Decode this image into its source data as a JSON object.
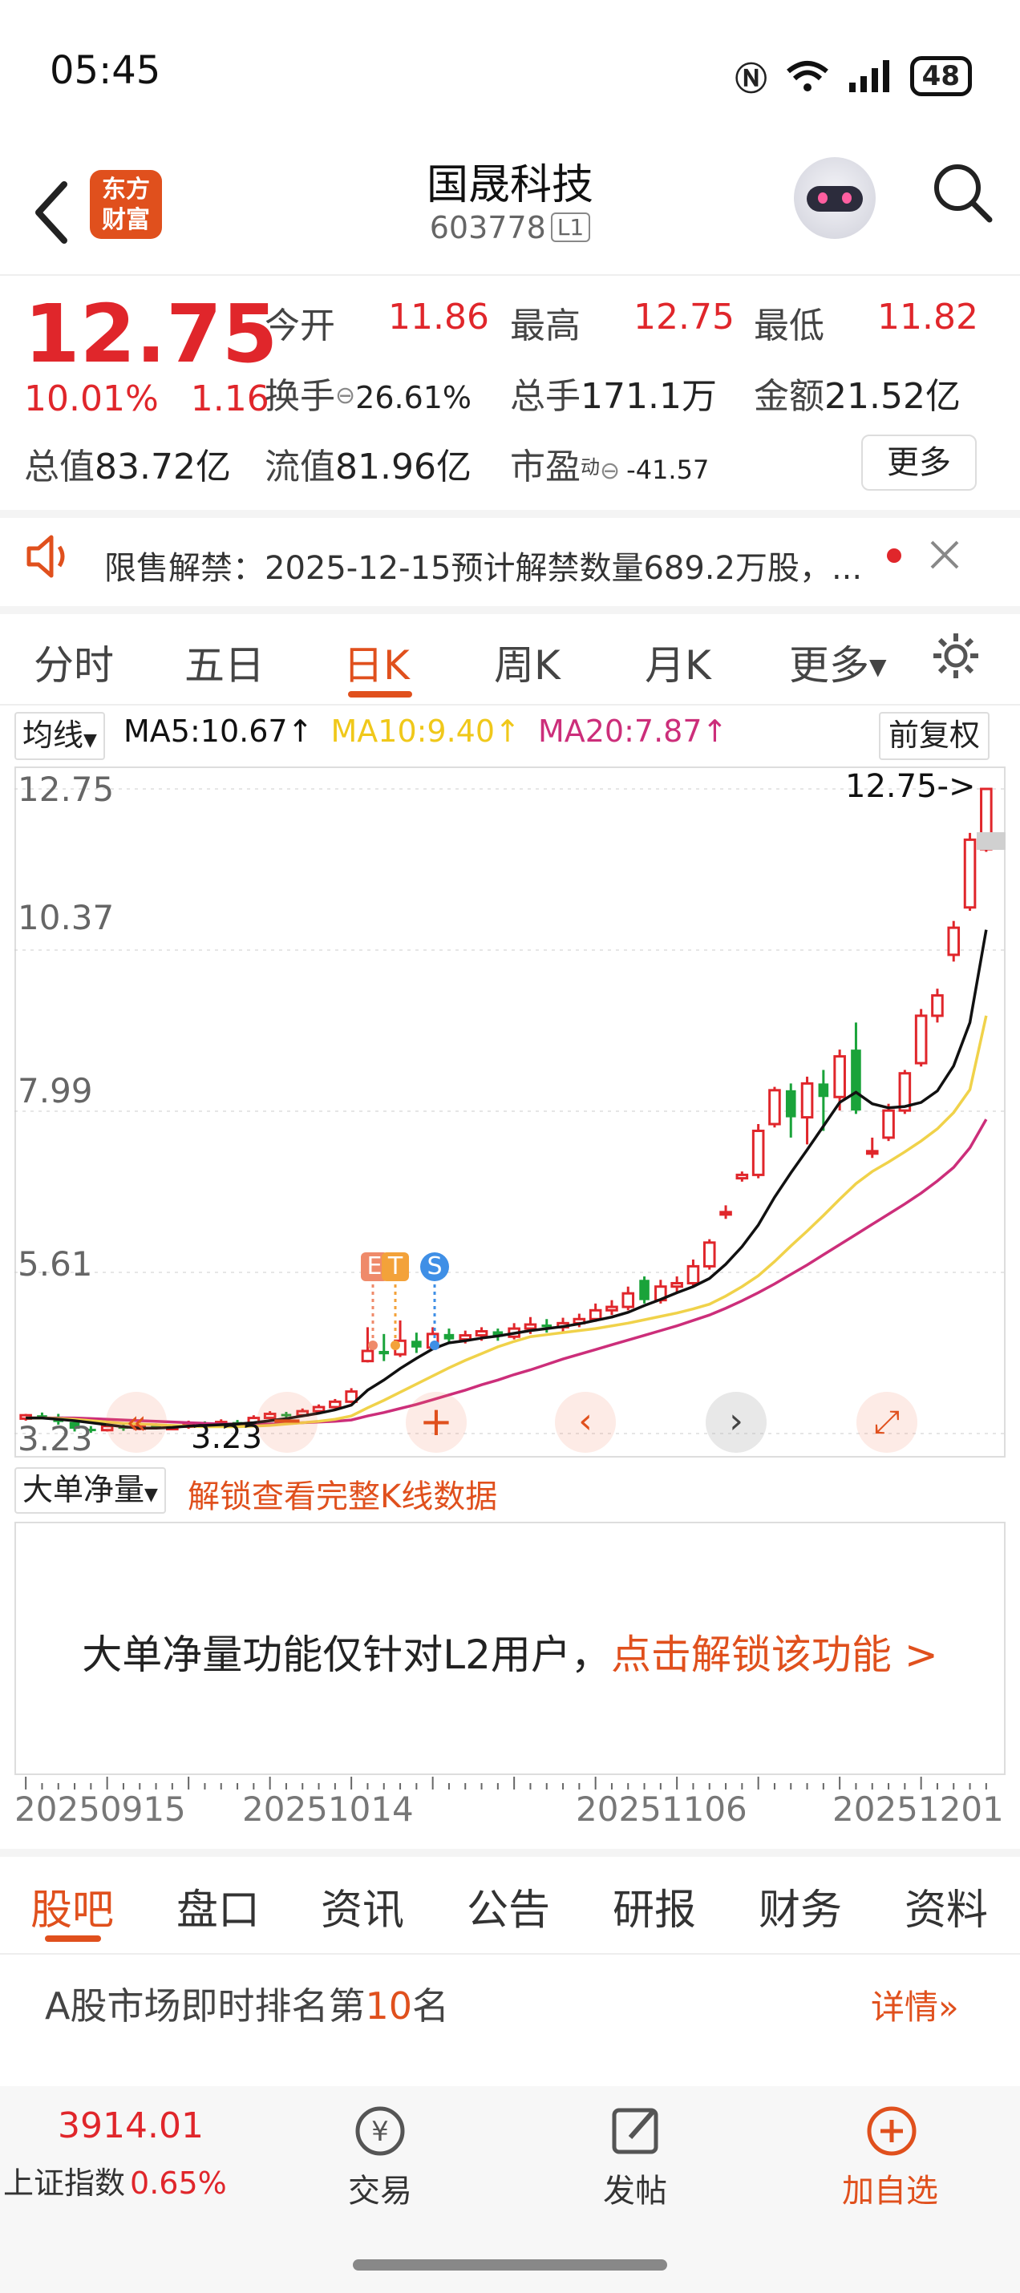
{
  "status": {
    "time": "05:45",
    "battery": "48"
  },
  "header": {
    "logo_line1": "东方",
    "logo_line2": "财富",
    "name": "国晟科技",
    "code": "603778",
    "level": "L1"
  },
  "quote": {
    "price": "12.75",
    "change_pct": "10.01%",
    "change": "1.16",
    "open_label": "今开",
    "open": "11.86",
    "high_label": "最高",
    "high": "12.75",
    "low_label": "最低",
    "low": "11.82",
    "turnover_label": "换手",
    "turnover": "26.61%",
    "volume_label": "总手",
    "volume": "171.1万",
    "amount_label": "金额",
    "amount": "21.52亿",
    "mcap_label": "总值",
    "mcap": "83.72亿",
    "float_label": "流值",
    "float_cap": "81.96亿",
    "pe_label": "市盈",
    "pe_sup": "动",
    "pe": "-41.57",
    "more": "更多"
  },
  "notice": {
    "text": "限售解禁：2025-12-15预计解禁数量689.2万股，..."
  },
  "tabs": [
    "分时",
    "五日",
    "日K",
    "周K",
    "月K",
    "更多"
  ],
  "ma": {
    "selector": "均线",
    "ma5": "MA5:10.67",
    "ma10": "MA10:9.40",
    "ma20": "MA20:7.87",
    "adjust": "前复权"
  },
  "chart": {
    "y_labels": [
      "12.75",
      "10.37",
      "7.99",
      "5.61",
      "3.23"
    ],
    "last_label": "12.75->",
    "low_label": "3.23",
    "markers": [
      "E",
      "T",
      "S"
    ],
    "colors": {
      "up": "#e0262b",
      "down": "#1aa33a",
      "ma5": "#111111",
      "ma10": "#f0d24a",
      "ma20": "#cc2e7a"
    }
  },
  "chart_data": {
    "type": "candlestick",
    "ylim": [
      3.23,
      12.75
    ],
    "candles": [
      [
        3.45,
        3.5,
        3.42,
        3.52
      ],
      [
        3.5,
        3.48,
        3.44,
        3.54
      ],
      [
        3.48,
        3.4,
        3.36,
        3.52
      ],
      [
        3.4,
        3.3,
        3.26,
        3.44
      ],
      [
        3.3,
        3.28,
        3.24,
        3.34
      ],
      [
        3.28,
        3.34,
        3.26,
        3.38
      ],
      [
        3.34,
        3.3,
        3.27,
        3.37
      ],
      [
        3.3,
        3.35,
        3.28,
        3.4
      ],
      [
        3.35,
        3.32,
        3.29,
        3.38
      ],
      [
        3.32,
        3.33,
        3.28,
        3.36
      ],
      [
        3.33,
        3.38,
        3.3,
        3.42
      ],
      [
        3.38,
        3.36,
        3.32,
        3.41
      ],
      [
        3.36,
        3.4,
        3.33,
        3.44
      ],
      [
        3.4,
        3.38,
        3.35,
        3.43
      ],
      [
        3.38,
        3.46,
        3.36,
        3.5
      ],
      [
        3.46,
        3.52,
        3.44,
        3.56
      ],
      [
        3.52,
        3.5,
        3.46,
        3.55
      ],
      [
        3.5,
        3.56,
        3.48,
        3.6
      ],
      [
        3.56,
        3.62,
        3.54,
        3.66
      ],
      [
        3.62,
        3.7,
        3.6,
        3.74
      ],
      [
        3.7,
        3.85,
        3.68,
        3.9
      ],
      [
        4.3,
        4.45,
        4.28,
        4.8
      ],
      [
        4.45,
        4.4,
        4.3,
        4.7
      ],
      [
        4.4,
        4.6,
        4.36,
        4.9
      ],
      [
        4.6,
        4.5,
        4.42,
        4.72
      ],
      [
        4.5,
        4.7,
        4.46,
        4.8
      ],
      [
        4.7,
        4.62,
        4.55,
        4.78
      ],
      [
        4.62,
        4.68,
        4.56,
        4.75
      ],
      [
        4.68,
        4.74,
        4.6,
        4.8
      ],
      [
        4.74,
        4.66,
        4.6,
        4.78
      ],
      [
        4.66,
        4.78,
        4.62,
        4.86
      ],
      [
        4.78,
        4.84,
        4.7,
        4.95
      ],
      [
        4.84,
        4.8,
        4.72,
        4.92
      ],
      [
        4.8,
        4.86,
        4.74,
        4.94
      ],
      [
        4.86,
        4.92,
        4.8,
        5.0
      ],
      [
        4.92,
        5.05,
        4.88,
        5.15
      ],
      [
        5.05,
        5.1,
        4.98,
        5.2
      ],
      [
        5.1,
        5.3,
        5.05,
        5.4
      ],
      [
        5.5,
        5.2,
        5.15,
        5.55
      ],
      [
        5.2,
        5.4,
        5.15,
        5.5
      ],
      [
        5.4,
        5.45,
        5.3,
        5.55
      ],
      [
        5.45,
        5.7,
        5.4,
        5.8
      ],
      [
        5.7,
        6.05,
        5.65,
        6.1
      ],
      [
        6.5,
        6.5,
        6.4,
        6.6
      ],
      [
        7.0,
        7.05,
        6.95,
        7.1
      ],
      [
        7.05,
        7.7,
        7.0,
        7.8
      ],
      [
        7.8,
        8.3,
        7.75,
        8.35
      ],
      [
        8.3,
        7.9,
        7.6,
        8.4
      ],
      [
        7.9,
        8.4,
        7.5,
        8.5
      ],
      [
        8.4,
        8.2,
        7.7,
        8.6
      ],
      [
        8.2,
        8.8,
        8.0,
        8.9
      ],
      [
        8.9,
        8.0,
        7.95,
        9.3
      ],
      [
        7.4,
        7.4,
        7.3,
        7.6
      ],
      [
        7.6,
        8.0,
        7.55,
        8.1
      ],
      [
        8.0,
        8.55,
        7.95,
        8.6
      ],
      [
        8.7,
        9.4,
        8.65,
        9.5
      ],
      [
        9.4,
        9.7,
        9.3,
        9.8
      ],
      [
        10.3,
        10.7,
        10.2,
        10.8
      ],
      [
        11.0,
        12.0,
        10.95,
        12.1
      ],
      [
        11.86,
        12.75,
        11.82,
        12.75
      ]
    ],
    "ma5": [
      3.46,
      3.46,
      3.44,
      3.42,
      3.39,
      3.36,
      3.33,
      3.31,
      3.31,
      3.32,
      3.34,
      3.35,
      3.36,
      3.37,
      3.39,
      3.42,
      3.45,
      3.49,
      3.53,
      3.58,
      3.65,
      3.87,
      4.02,
      4.19,
      4.34,
      4.48,
      4.57,
      4.6,
      4.64,
      4.67,
      4.71,
      4.75,
      4.78,
      4.81,
      4.85,
      4.9,
      4.95,
      5.02,
      5.12,
      5.21,
      5.31,
      5.4,
      5.52,
      5.73,
      5.99,
      6.31,
      6.72,
      7.08,
      7.42,
      7.77,
      8.12,
      8.27,
      8.1,
      8.04,
      8.06,
      8.12,
      8.29,
      8.66,
      9.3,
      10.67
    ],
    "ma10": [
      3.46,
      3.46,
      3.45,
      3.44,
      3.42,
      3.4,
      3.38,
      3.37,
      3.36,
      3.35,
      3.34,
      3.33,
      3.33,
      3.33,
      3.34,
      3.35,
      3.37,
      3.39,
      3.41,
      3.44,
      3.49,
      3.61,
      3.72,
      3.84,
      3.96,
      4.08,
      4.2,
      4.31,
      4.41,
      4.51,
      4.59,
      4.66,
      4.69,
      4.72,
      4.75,
      4.78,
      4.82,
      4.86,
      4.91,
      4.96,
      5.01,
      5.07,
      5.14,
      5.26,
      5.4,
      5.56,
      5.77,
      6.0,
      6.22,
      6.45,
      6.69,
      6.92,
      7.1,
      7.24,
      7.39,
      7.55,
      7.73,
      7.97,
      8.31,
      9.4
    ],
    "ma20": [
      3.46,
      3.46,
      3.46,
      3.46,
      3.45,
      3.44,
      3.43,
      3.42,
      3.41,
      3.4,
      3.39,
      3.38,
      3.37,
      3.37,
      3.37,
      3.37,
      3.38,
      3.39,
      3.4,
      3.41,
      3.43,
      3.49,
      3.54,
      3.6,
      3.66,
      3.73,
      3.8,
      3.87,
      3.95,
      4.02,
      4.1,
      4.17,
      4.25,
      4.33,
      4.4,
      4.47,
      4.54,
      4.61,
      4.68,
      4.75,
      4.82,
      4.9,
      4.98,
      5.08,
      5.19,
      5.31,
      5.44,
      5.58,
      5.72,
      5.87,
      6.02,
      6.17,
      6.32,
      6.47,
      6.62,
      6.78,
      6.96,
      7.16,
      7.45,
      7.87
    ]
  },
  "lower": {
    "selector": "大单净量",
    "unlock_link": "解锁查看完整K线数据",
    "message": "大单净量功能仅针对L2用户，",
    "message_link": "点击解锁该功能 >"
  },
  "dates": [
    "20250915",
    "20251014",
    "20251106",
    "20251201"
  ],
  "bottom_tabs": [
    "股吧",
    "盘口",
    "资讯",
    "公告",
    "研报",
    "财务",
    "资料"
  ],
  "rank": {
    "prefix": "A股市场即时排名第",
    "num": "10",
    "suffix": "名",
    "detail": "详情"
  },
  "footer": {
    "index_value": "3914.01",
    "index_name": "上证指数",
    "index_change": "0.65%",
    "trade": "交易",
    "post": "发帖",
    "add": "加自选"
  }
}
